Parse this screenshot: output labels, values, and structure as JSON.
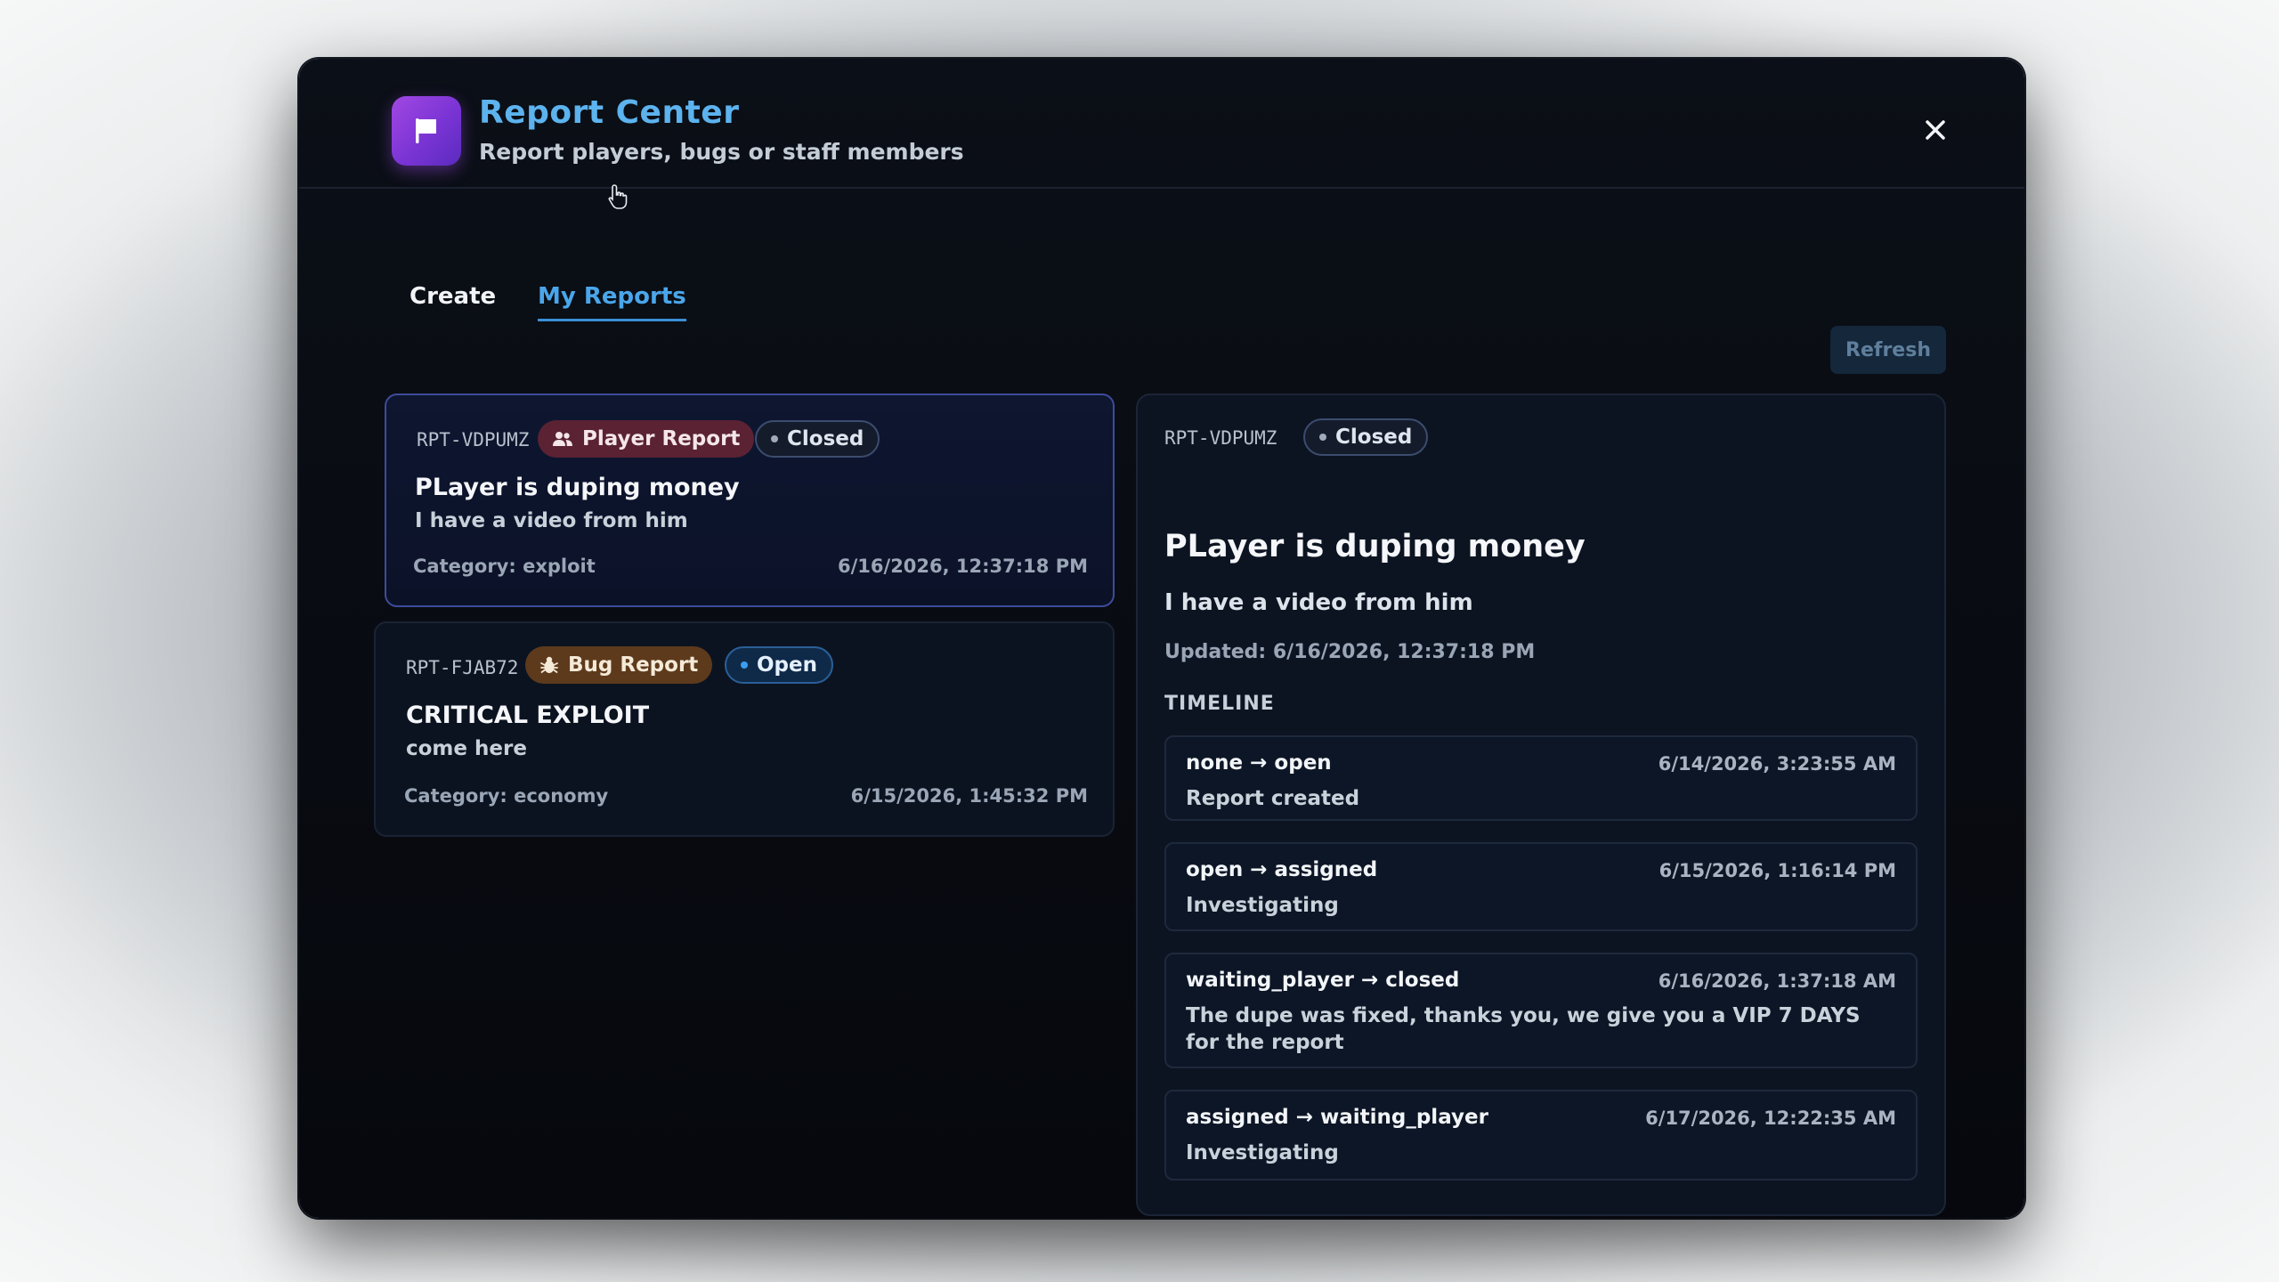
{
  "header": {
    "title": "Report Center",
    "subtitle": "Report players, bugs or staff members",
    "close_icon": "close-icon",
    "logo_icon": "flag-icon"
  },
  "tabs": [
    {
      "label": "Create",
      "active": false
    },
    {
      "label": "My Reports",
      "active": true
    }
  ],
  "toolbar": {
    "refresh_label": "Refresh"
  },
  "reports": [
    {
      "id": "RPT-VDPUMZ",
      "type_label": "Player Report",
      "type_icon": "users-icon",
      "status": "Closed",
      "title": "PLayer is duping money",
      "description": "I have a video from him",
      "category": "Category: exploit",
      "date": "6/16/2026, 12:37:18 PM",
      "selected": true
    },
    {
      "id": "RPT-FJAB72",
      "type_label": "Bug Report",
      "type_icon": "bug-icon",
      "status": "Open",
      "title": "CRITICAL EXPLOIT",
      "description": "come here",
      "category": "Category: economy",
      "date": "6/15/2026, 1:45:32 PM",
      "selected": false
    }
  ],
  "detail": {
    "id": "RPT-VDPUMZ",
    "status": "Closed",
    "title": "PLayer is duping money",
    "description": "I have a video from him",
    "updated": "Updated: 6/16/2026, 12:37:18 PM",
    "timeline_label": "TIMELINE",
    "timeline": [
      {
        "transition": "none → open",
        "date": "6/14/2026, 3:23:55 AM",
        "note": "Report created"
      },
      {
        "transition": "open → assigned",
        "date": "6/15/2026, 1:16:14 PM",
        "note": "Investigating"
      },
      {
        "transition": "waiting_player → closed",
        "date": "6/16/2026, 1:37:18 AM",
        "note": "The dupe was fixed, thanks you, we give you a VIP 7 DAYS for the report"
      },
      {
        "transition": "assigned → waiting_player",
        "date": "6/17/2026, 12:22:35 AM",
        "note": "Investigating"
      }
    ]
  },
  "colors": {
    "accent": "#4aa6ea",
    "logo": "#8b3fdc",
    "player_badge": "#5a2233",
    "bug_badge": "#5e3a1c",
    "open_badge": "#0f2a48"
  }
}
